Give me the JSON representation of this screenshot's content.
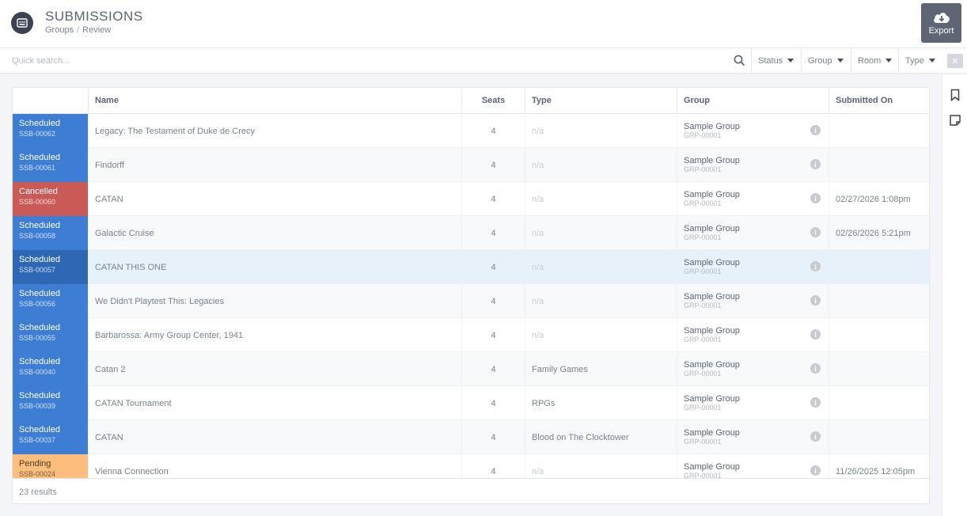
{
  "header": {
    "title": "SUBMISSIONS",
    "breadcrumb": [
      "Groups",
      "Review"
    ],
    "export_label": "Export"
  },
  "toolbar": {
    "search_placeholder": "Quick search...",
    "filters": [
      "Status",
      "Room",
      "Type"
    ],
    "group_filter": "Group",
    "clear_label": "✕"
  },
  "table": {
    "columns": [
      "Name",
      "Seats",
      "Type",
      "Group",
      "Submitted On"
    ],
    "status_colors": {
      "Scheduled": "#3d7dd3",
      "Cancelled": "#c95a57",
      "Pending": "#fdbe7d",
      "Selected": "#2e68b4"
    },
    "rows": [
      {
        "status": "Scheduled",
        "id": "SSB-00062",
        "name": "Legacy: The Testament of Duke de Crecy",
        "seats": "4",
        "type": "n/a",
        "group": "Sample Group",
        "group_id": "GRP-00001",
        "submitted": ""
      },
      {
        "status": "Scheduled",
        "id": "SSB-00061",
        "name": "Findorff",
        "seats": "4",
        "type": "n/a",
        "group": "Sample Group",
        "group_id": "GRP-00001",
        "submitted": ""
      },
      {
        "status": "Cancelled",
        "id": "SSB-00060",
        "name": "CATAN",
        "seats": "4",
        "type": "n/a",
        "group": "Sample Group",
        "group_id": "GRP-00001",
        "submitted": "02/27/2026 1:08pm"
      },
      {
        "status": "Scheduled",
        "id": "SSB-00058",
        "name": "Galactic Cruise",
        "seats": "4",
        "type": "n/a",
        "group": "Sample Group",
        "group_id": "GRP-00001",
        "submitted": "02/26/2026 5:21pm"
      },
      {
        "status": "Scheduled",
        "id": "SSB-00057",
        "name": "CATAN THIS ONE",
        "seats": "4",
        "type": "n/a",
        "group": "Sample Group",
        "group_id": "GRP-00001",
        "submitted": "",
        "selected": true
      },
      {
        "status": "Scheduled",
        "id": "SSB-00056",
        "name": "We Didn't Playtest This: Legacies",
        "seats": "4",
        "type": "n/a",
        "group": "Sample Group",
        "group_id": "GRP-00001",
        "submitted": ""
      },
      {
        "status": "Scheduled",
        "id": "SSB-00055",
        "name": "Barbarossa: Army Group Center, 1941",
        "seats": "4",
        "type": "n/a",
        "group": "Sample Group",
        "group_id": "GRP-00001",
        "submitted": ""
      },
      {
        "status": "Scheduled",
        "id": "SSB-00040",
        "name": "Catan 2",
        "seats": "4",
        "type": "Family Games",
        "group": "Sample Group",
        "group_id": "GRP-00001",
        "submitted": ""
      },
      {
        "status": "Scheduled",
        "id": "SSB-00039",
        "name": "CATAN Tournament",
        "seats": "4",
        "type": "RPGs",
        "group": "Sample Group",
        "group_id": "GRP-00001",
        "submitted": ""
      },
      {
        "status": "Scheduled",
        "id": "SSB-00037",
        "name": "CATAN",
        "seats": "4",
        "type": "Blood on The Clocktower",
        "group": "Sample Group",
        "group_id": "GRP-00001",
        "submitted": ""
      },
      {
        "status": "Pending",
        "id": "SSB-00024",
        "name": "Vienna Connection",
        "seats": "4",
        "type": "n/a",
        "group": "Sample Group",
        "group_id": "GRP-00001",
        "submitted": "11/26/2025 12:05pm"
      }
    ]
  },
  "footer": {
    "results": "23 results"
  },
  "icons": {
    "app": "calendar-grid-icon",
    "export": "cloud-download-icon",
    "search": "search-icon",
    "info": "info-icon",
    "bookmark": "bookmark-icon",
    "note": "sticky-note-icon"
  }
}
